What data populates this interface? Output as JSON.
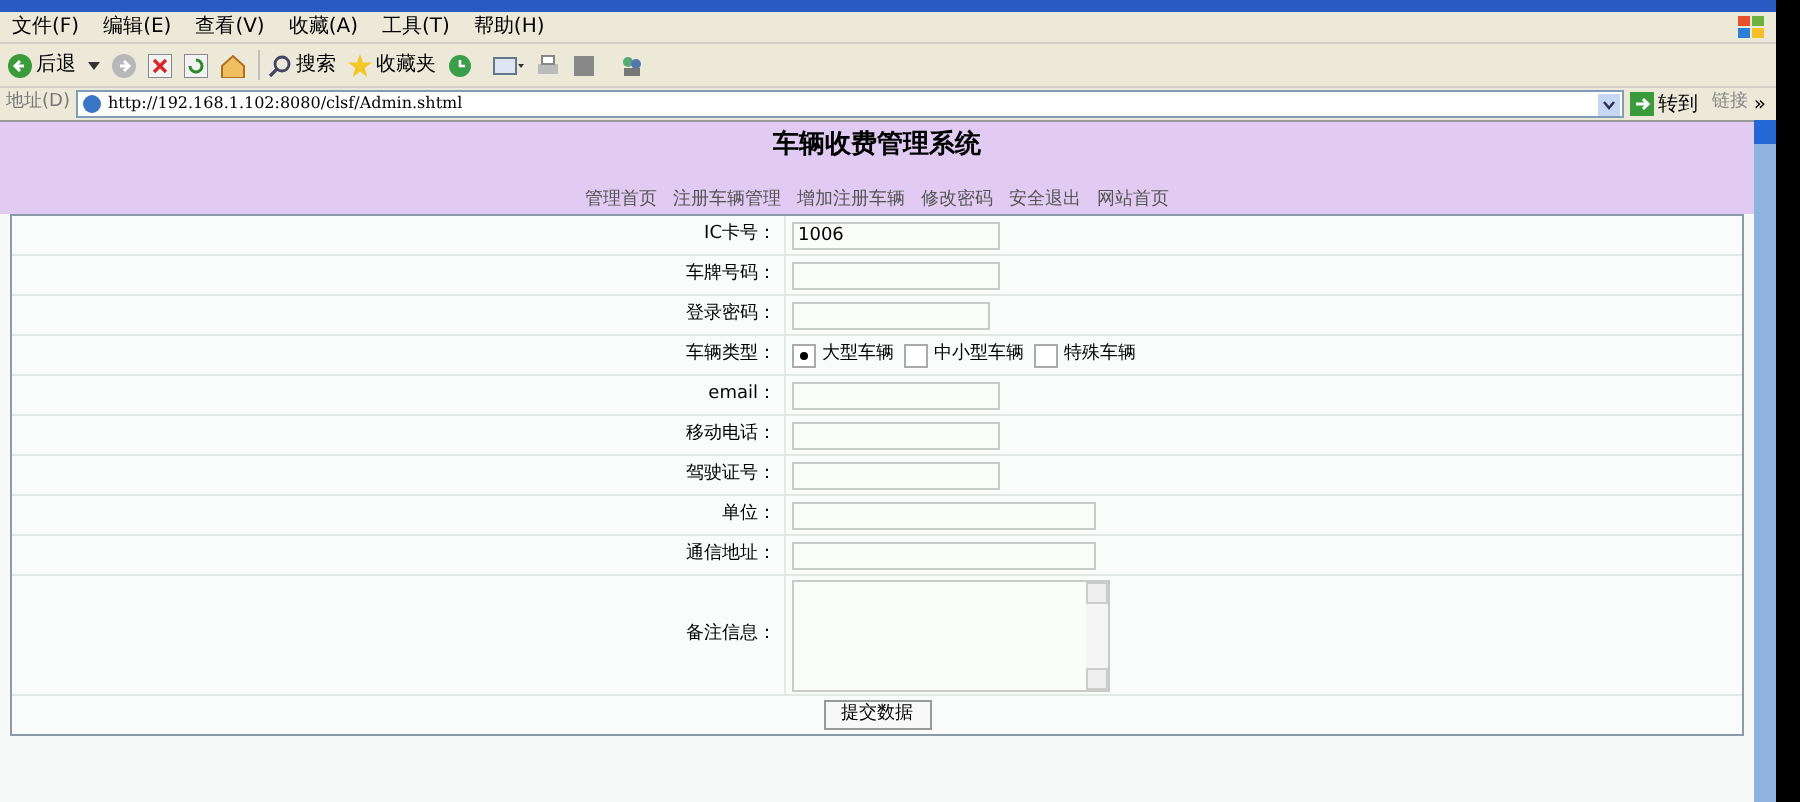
{
  "menu_bar": [
    "文件(F)",
    "编辑(E)",
    "查看(V)",
    "收藏(A)",
    "工具(T)",
    "帮助(H)"
  ],
  "toolbar": {
    "back": "后退",
    "search": "搜索",
    "favorites": "收藏夹"
  },
  "address_bar": {
    "label": "地址(D)",
    "url": "http://192.168.1.102:8080/clsf/Admin.shtml",
    "go": "转到",
    "links": "链接",
    "more": "»"
  },
  "page": {
    "title": "车辆收费管理系统",
    "nav": [
      "管理首页",
      "注册车辆管理",
      "增加注册车辆",
      "修改密码",
      "安全退出",
      "网站首页"
    ],
    "form": [
      {
        "kind": "text",
        "label": "IC卡号：",
        "value": "1006"
      },
      {
        "kind": "text",
        "label": "车牌号码："
      },
      {
        "kind": "password",
        "label": "登录密码："
      },
      {
        "kind": "radio",
        "label": "车辆类型：",
        "options": [
          {
            "label": "大型车辆",
            "selected": true
          },
          {
            "label": "中小型车辆",
            "selected": false
          },
          {
            "label": "特殊车辆",
            "selected": false
          }
        ]
      },
      {
        "kind": "text",
        "label": "email："
      },
      {
        "kind": "text",
        "label": "移动电话："
      },
      {
        "kind": "text",
        "label": "驾驶证号："
      },
      {
        "kind": "wide",
        "label": "单位："
      },
      {
        "kind": "wide",
        "label": "通信地址："
      },
      {
        "kind": "textarea",
        "label": "备注信息："
      }
    ],
    "submit": "提交数据"
  }
}
